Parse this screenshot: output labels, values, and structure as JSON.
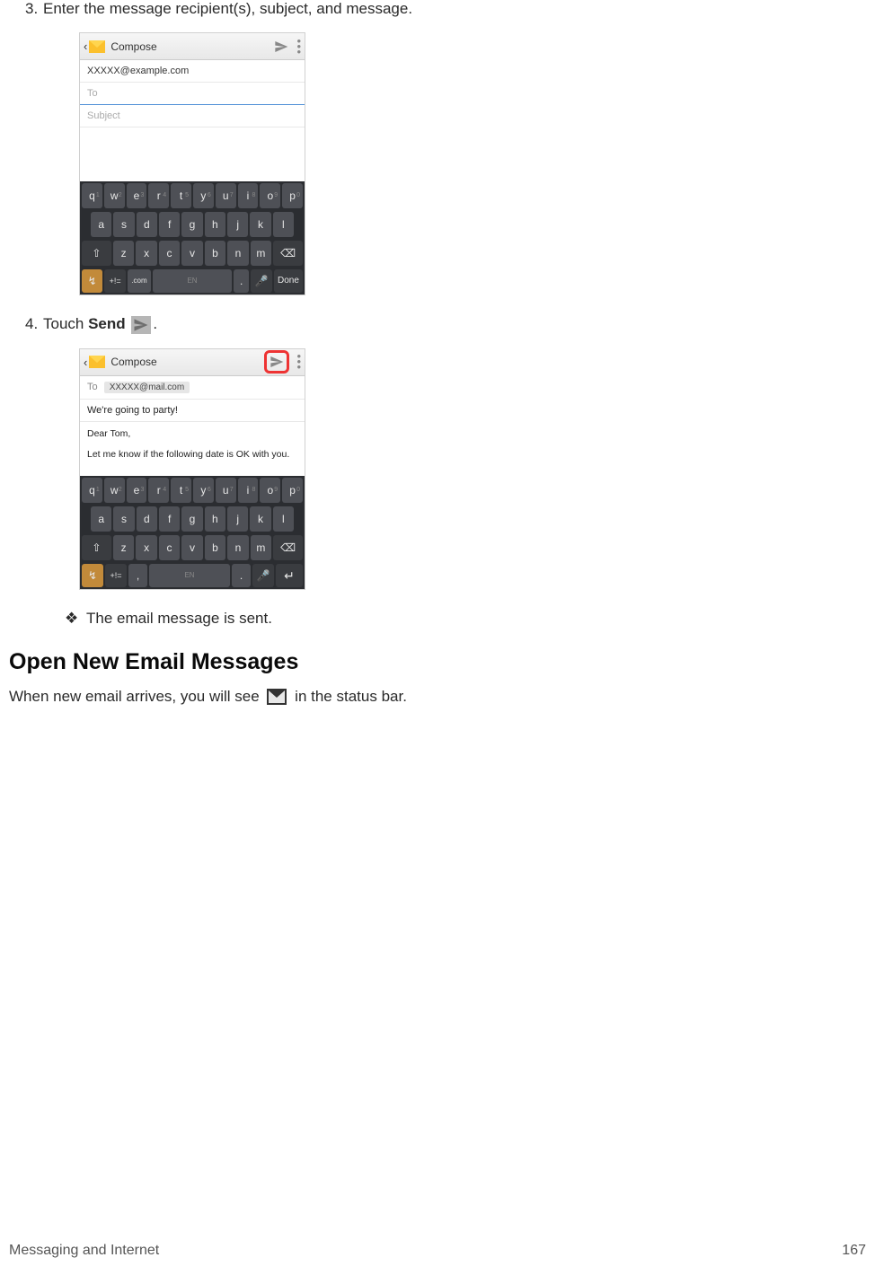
{
  "step3": {
    "num": "3.",
    "text": "Enter the message recipient(s), subject, and message."
  },
  "step4": {
    "num": "4.",
    "text_pre": "Touch ",
    "text_bold": "Send",
    "text_post": " "
  },
  "result": {
    "bullet": "❖",
    "text": "The email message is sent."
  },
  "section_heading": "Open New Email Messages",
  "section_body_pre": "When new email arrives, you will see ",
  "section_body_post": " in the status bar.",
  "shot1": {
    "title": "Compose",
    "from": "XXXXX@example.com",
    "to": "To",
    "subject": "Subject"
  },
  "shot2": {
    "title": "Compose",
    "to_label": "To",
    "to_chip": "XXXXX@mail.com",
    "subject": "We're going to party!",
    "body_line1": "Dear Tom,",
    "body_line2": "Let me know if the following date is OK with you."
  },
  "kb": {
    "row1": [
      "q",
      "w",
      "e",
      "r",
      "t",
      "y",
      "u",
      "i",
      "o",
      "p"
    ],
    "row2": [
      "a",
      "s",
      "d",
      "f",
      "g",
      "h",
      "j",
      "k",
      "l"
    ],
    "row3": [
      "⇧",
      "z",
      "x",
      "c",
      "v",
      "b",
      "n",
      "m",
      "⌫"
    ],
    "row4_sym": "+!=",
    "row4_com": ".com",
    "row4_space": "EN",
    "row4_mic": "🎤",
    "row4_done": "Done",
    "row4_enter": "↵",
    "row4_dot": "."
  },
  "footer": {
    "left": "Messaging and Internet",
    "right": "167"
  }
}
